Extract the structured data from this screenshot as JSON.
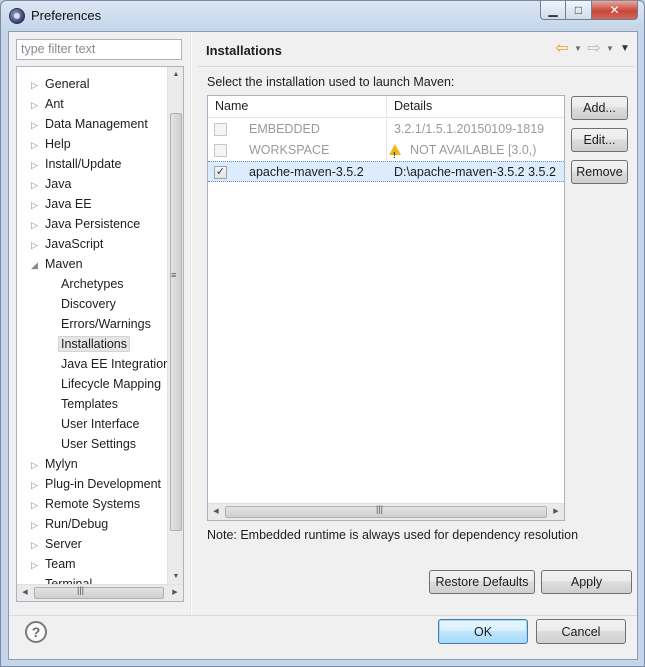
{
  "window": {
    "title": "Preferences",
    "minimize": "▁",
    "maximize": "□",
    "close": "✕"
  },
  "filter": {
    "placeholder": "type filter text"
  },
  "tree": {
    "items": [
      {
        "label": "General",
        "expander": "▷"
      },
      {
        "label": "Ant",
        "expander": "▷"
      },
      {
        "label": "Data Management",
        "expander": "▷"
      },
      {
        "label": "Help",
        "expander": "▷"
      },
      {
        "label": "Install/Update",
        "expander": "▷"
      },
      {
        "label": "Java",
        "expander": "▷"
      },
      {
        "label": "Java EE",
        "expander": "▷"
      },
      {
        "label": "Java Persistence",
        "expander": "▷"
      },
      {
        "label": "JavaScript",
        "expander": "▷"
      },
      {
        "label": "Maven",
        "expander": "◢"
      },
      {
        "label": "Archetypes",
        "expander": ""
      },
      {
        "label": "Discovery",
        "expander": ""
      },
      {
        "label": "Errors/Warnings",
        "expander": ""
      },
      {
        "label": "Installations",
        "expander": ""
      },
      {
        "label": "Java EE Integration",
        "expander": ""
      },
      {
        "label": "Lifecycle Mapping",
        "expander": ""
      },
      {
        "label": "Templates",
        "expander": ""
      },
      {
        "label": "User Interface",
        "expander": ""
      },
      {
        "label": "User Settings",
        "expander": ""
      },
      {
        "label": "Mylyn",
        "expander": "▷"
      },
      {
        "label": "Plug-in Development",
        "expander": "▷"
      },
      {
        "label": "Remote Systems",
        "expander": "▷"
      },
      {
        "label": "Run/Debug",
        "expander": "▷"
      },
      {
        "label": "Server",
        "expander": "▷"
      },
      {
        "label": "Team",
        "expander": "▷"
      },
      {
        "label": "Terminal",
        "expander": ""
      }
    ],
    "selected": "Installations"
  },
  "page": {
    "title": "Installations",
    "prompt": "Select the installation used to launch Maven:",
    "columns": {
      "name": "Name",
      "details": "Details"
    },
    "rows": [
      {
        "checked": false,
        "check": "",
        "name": "EMBEDDED",
        "details": "3.2.1/1.5.1.20150109-1819",
        "greyed": true,
        "warning": false
      },
      {
        "checked": false,
        "check": "",
        "name": "WORKSPACE",
        "details": "NOT AVAILABLE [3.0,)",
        "greyed": true,
        "warning": true
      },
      {
        "checked": true,
        "check": "✓",
        "name": "apache-maven-3.5.2",
        "details": "D:\\apache-maven-3.5.2 3.5.2",
        "greyed": false,
        "warning": false
      }
    ],
    "buttons": {
      "add": "Add...",
      "edit": "Edit...",
      "remove": "Remove"
    },
    "note": "Note: Embedded runtime is always used for dependency resolution",
    "restore_defaults": "Restore Defaults",
    "apply": "Apply"
  },
  "nav": {
    "back_icon": "⇦",
    "forward_icon": "⇨",
    "dropdown_icon": "▼",
    "menu_icon": "▼"
  },
  "dialog": {
    "ok": "OK",
    "cancel": "Cancel",
    "help_icon": "?"
  },
  "scroll": {
    "up": "▲",
    "down": "▼",
    "left": "◀",
    "right": "▶",
    "grip_v": "≡",
    "grip_h": "|||"
  },
  "colors": {
    "selection": "#dcecfc",
    "accent": "#3c7fb1",
    "warning": "#f0b716"
  }
}
